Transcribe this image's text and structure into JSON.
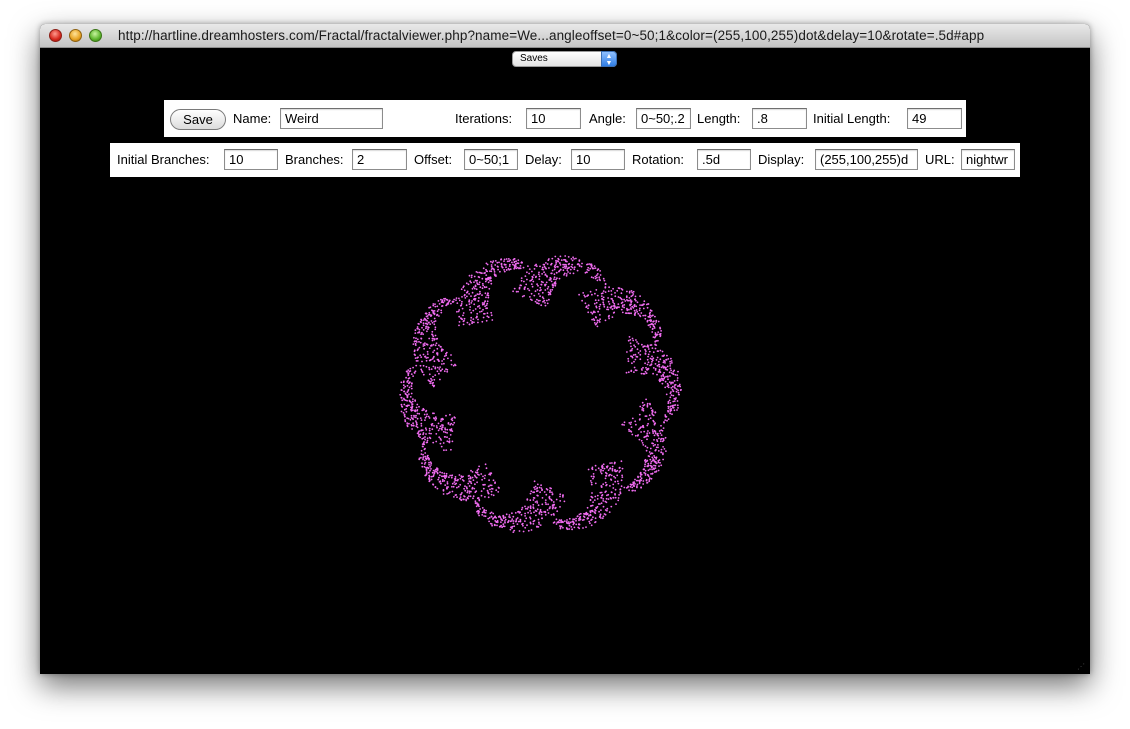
{
  "window": {
    "title": "http://hartline.dreamhosters.com/Fractal/fractalviewer.php?name=We...angleoffset=0~50;1&color=(255,100,255)dot&delay=10&rotate=.5d#app"
  },
  "saves": {
    "selected": "Saves"
  },
  "controls": {
    "save_label": "Save",
    "name_label": "Name:",
    "name_value": "Weird",
    "iterations_label": "Iterations:",
    "iterations_value": "10",
    "angle_label": "Angle:",
    "angle_value": "0~50;.2",
    "length_label": "Length:",
    "length_value": ".8",
    "initial_length_label": "Initial Length:",
    "initial_length_value": "49",
    "initial_branches_label": "Initial Branches:",
    "initial_branches_value": "10",
    "branches_label": "Branches:",
    "branches_value": "2",
    "offset_label": "Offset:",
    "offset_value": "0~50;1",
    "delay_label": "Delay:",
    "delay_value": "10",
    "rotation_label": "Rotation:",
    "rotation_value": ".5d",
    "display_label": "Display:",
    "display_value": "(255,100,255)d",
    "url_label": "URL:",
    "url_value": "nightwr"
  },
  "fractal": {
    "color": "#f06cf0",
    "initial_branches": 10
  },
  "icons": {
    "close": "close-icon",
    "minimize": "minimize-icon",
    "maximize": "maximize-icon",
    "select_arrows": "updown-arrows-icon",
    "resize": "resize-grip-icon"
  }
}
